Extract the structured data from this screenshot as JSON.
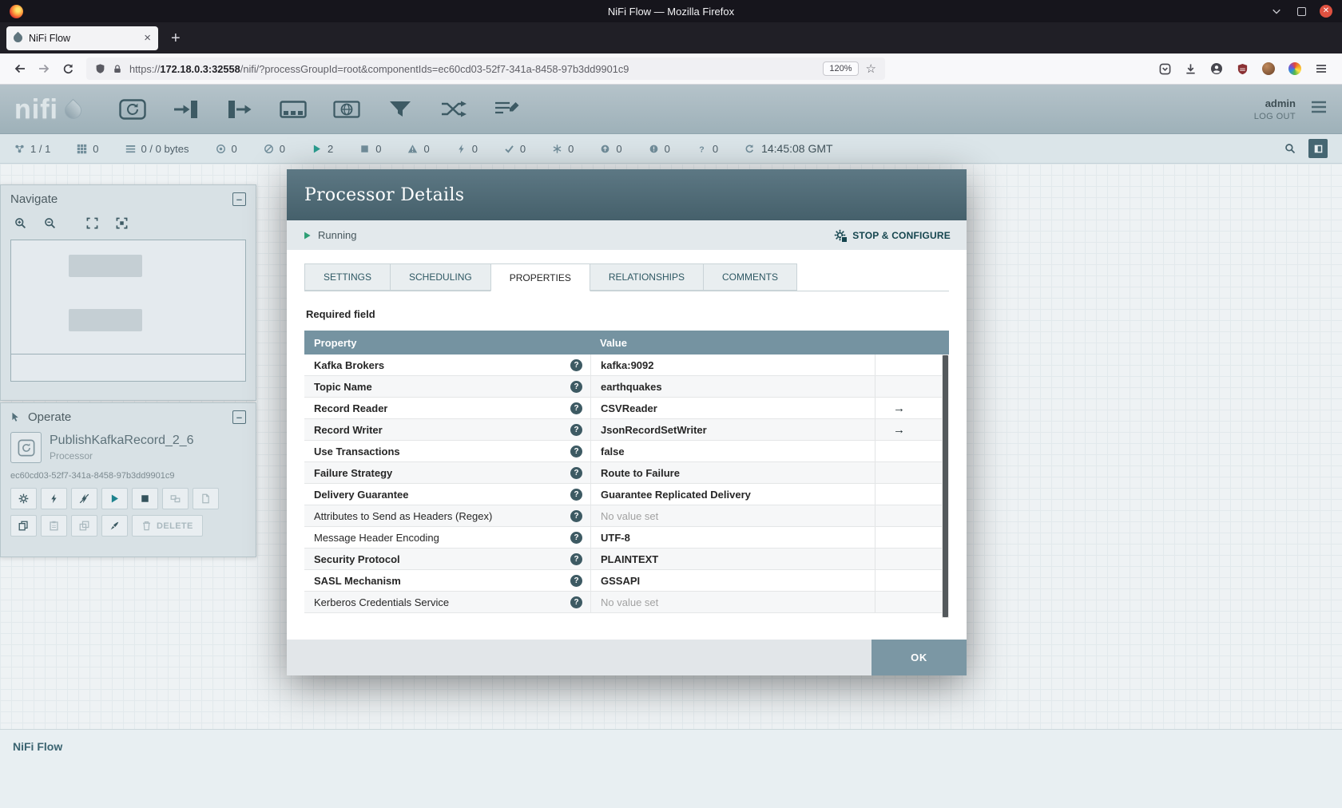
{
  "window": {
    "title": "NiFi Flow — Mozilla Firefox"
  },
  "browser": {
    "tab_title": "NiFi Flow",
    "new_tab_label": "+",
    "url": {
      "scheme": "https://",
      "host": "172.18.0.3:32558",
      "path": "/nifi/?processGroupId=root&componentIds=ec60cd03-52f7-341a-8458-97b3dd9901c9"
    },
    "zoom_level": "120%",
    "right_icons": [
      "pocket-icon",
      "downloads-icon",
      "account-icon",
      "ublock-icon",
      "avatar-icon",
      "extension-icon",
      "menu-icon"
    ]
  },
  "nifi": {
    "logo_text": "nifi",
    "user": "admin",
    "logout_label": "LOG OUT",
    "toolbar_icons": [
      "processor-icon",
      "input-port-icon",
      "output-port-icon",
      "process-group-icon",
      "remote-process-group-icon",
      "funnel-icon",
      "template-icon",
      "label-icon"
    ],
    "status": {
      "items": [
        {
          "icon": "cluster-icon",
          "value": "1 / 1"
        },
        {
          "icon": "threads-icon",
          "value": "0"
        },
        {
          "icon": "queued-icon",
          "value": "0 / 0 bytes"
        },
        {
          "icon": "transmitting-icon",
          "value": "0"
        },
        {
          "icon": "not-transmitting-icon",
          "value": "0"
        },
        {
          "icon": "running-icon",
          "value": "2"
        },
        {
          "icon": "stopped-icon",
          "value": "0"
        },
        {
          "icon": "invalid-icon",
          "value": "0"
        },
        {
          "icon": "disabled-icon",
          "value": "0"
        },
        {
          "icon": "up-to-date-icon",
          "value": "0"
        },
        {
          "icon": "locally-modified-icon",
          "value": "0"
        },
        {
          "icon": "stale-icon",
          "value": "0"
        },
        {
          "icon": "locally-modified-stale-icon",
          "value": "0"
        },
        {
          "icon": "sync-failure-icon",
          "value": "0"
        }
      ],
      "time": "14:45:08 GMT"
    }
  },
  "navigate": {
    "title": "Navigate",
    "buttons": [
      "zoom-in-icon",
      "zoom-out-icon",
      "zoom-fit-icon",
      "zoom-actual-icon"
    ]
  },
  "operate": {
    "title": "Operate",
    "name": "PublishKafkaRecord_2_6",
    "type": "Processor",
    "id": "ec60cd03-52f7-341a-8458-97b3dd9901c9",
    "buttons_row1": [
      {
        "icon": "configure-icon",
        "enabled": true
      },
      {
        "icon": "enable-icon",
        "enabled": true
      },
      {
        "icon": "disable-icon",
        "enabled": true
      },
      {
        "icon": "start-icon",
        "enabled": true,
        "accent": "start"
      },
      {
        "icon": "stop-icon",
        "enabled": true,
        "accent": "stop"
      },
      {
        "icon": "group-icon",
        "enabled": false
      },
      {
        "icon": "create-template-icon",
        "enabled": false
      }
    ],
    "buttons_row2": [
      {
        "icon": "copy-icon",
        "enabled": true
      },
      {
        "icon": "paste-icon",
        "enabled": false
      },
      {
        "icon": "move-to-front-icon",
        "enabled": false
      },
      {
        "icon": "fill-color-icon",
        "enabled": true
      }
    ],
    "delete_label": "DELETE"
  },
  "dialog": {
    "title": "Processor Details",
    "state_label": "Running",
    "action_label": "STOP & CONFIGURE",
    "tabs": [
      {
        "label": "SETTINGS",
        "active": false
      },
      {
        "label": "SCHEDULING",
        "active": false
      },
      {
        "label": "PROPERTIES",
        "active": true
      },
      {
        "label": "RELATIONSHIPS",
        "active": false
      },
      {
        "label": "COMMENTS",
        "active": false
      }
    ],
    "required_label": "Required field",
    "columns": {
      "property": "Property",
      "value": "Value"
    },
    "rows": [
      {
        "property": "Kafka Brokers",
        "required": true,
        "value": "kafka:9092",
        "value_set": true,
        "has_goto": false
      },
      {
        "property": "Topic Name",
        "required": true,
        "value": "earthquakes",
        "value_set": true,
        "has_goto": false
      },
      {
        "property": "Record Reader",
        "required": true,
        "value": "CSVReader",
        "value_set": true,
        "has_goto": true
      },
      {
        "property": "Record Writer",
        "required": true,
        "value": "JsonRecordSetWriter",
        "value_set": true,
        "has_goto": true
      },
      {
        "property": "Use Transactions",
        "required": true,
        "value": "false",
        "value_set": true,
        "has_goto": false
      },
      {
        "property": "Failure Strategy",
        "required": true,
        "value": "Route to Failure",
        "value_set": true,
        "has_goto": false
      },
      {
        "property": "Delivery Guarantee",
        "required": true,
        "value": "Guarantee Replicated Delivery",
        "value_set": true,
        "has_goto": false
      },
      {
        "property": "Attributes to Send as Headers (Regex)",
        "required": false,
        "value": "No value set",
        "value_set": false,
        "has_goto": false
      },
      {
        "property": "Message Header Encoding",
        "required": false,
        "value": "UTF-8",
        "value_set": true,
        "has_goto": false
      },
      {
        "property": "Security Protocol",
        "required": true,
        "value": "PLAINTEXT",
        "value_set": true,
        "has_goto": false
      },
      {
        "property": "SASL Mechanism",
        "required": true,
        "value": "GSSAPI",
        "value_set": true,
        "has_goto": false
      },
      {
        "property": "Kerberos Credentials Service",
        "required": false,
        "value": "No value set",
        "value_set": false,
        "has_goto": false
      }
    ],
    "ok_label": "OK"
  },
  "footer": {
    "breadcrumb": "NiFi Flow"
  }
}
